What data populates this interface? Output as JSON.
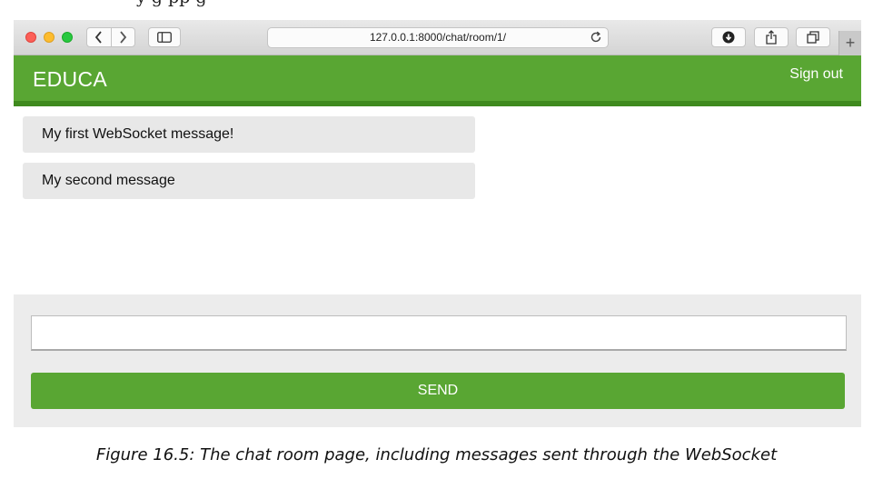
{
  "page_top_text": "y          g  pp                    g",
  "browser": {
    "url": "127.0.0.1:8000/chat/room/1/",
    "newtab_label": "+",
    "icons": {
      "back": "chevron-left-icon",
      "forward": "chevron-right-icon",
      "sidebar": "sidebar-icon",
      "reload": "reload-icon",
      "download": "download-icon",
      "share": "share-icon",
      "tabs": "tabs-overview-icon"
    }
  },
  "header": {
    "logo": "EDUCA",
    "signout_label": "Sign out"
  },
  "chat": {
    "messages": [
      "My first WebSocket message!",
      "My second message"
    ],
    "input_value": "",
    "send_label": "SEND"
  },
  "caption": "Figure 16.5: The chat room page, including messages sent through the WebSocket",
  "colors": {
    "brand_green": "#59a633",
    "header_border": "#3f8a1e",
    "message_bg": "#e8e8e8",
    "form_bg": "#ececec"
  }
}
